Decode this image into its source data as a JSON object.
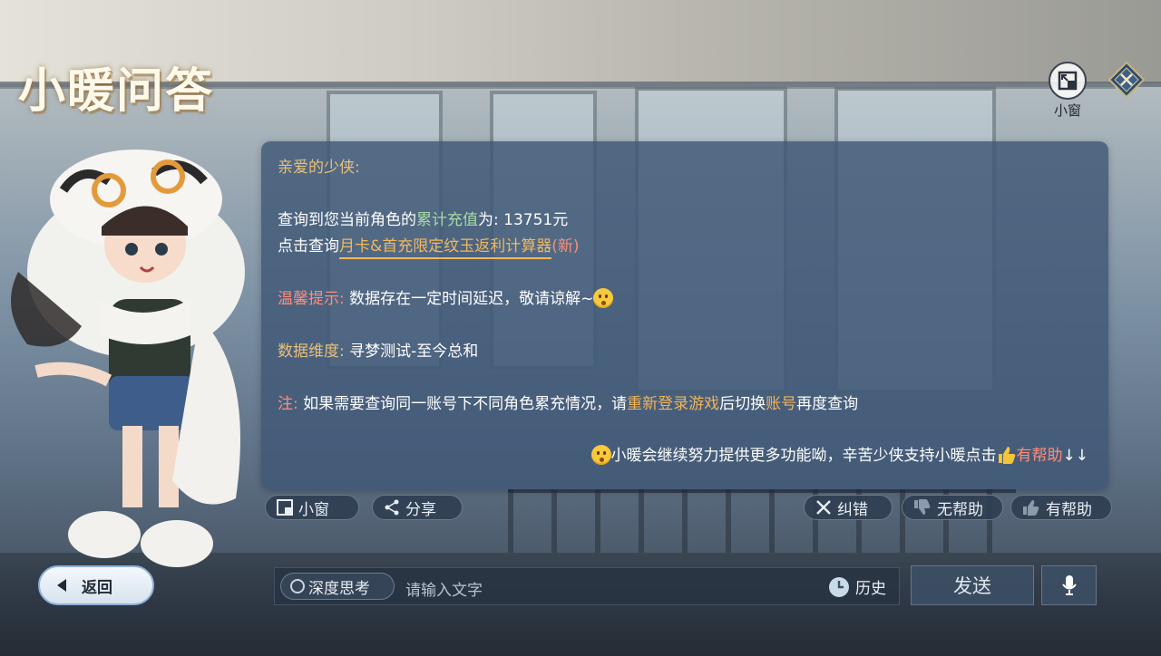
{
  "header": {
    "title": "小暖问答",
    "mini_window_label": "小窗"
  },
  "dialog": {
    "greeting": "亲爱的少侠:",
    "query_prefix": "查询到您当前角色的",
    "query_highlight": "累计充值",
    "query_suffix": "为: 13751元",
    "click_prefix": "点击查询",
    "calculator_link": "月卡&首充限定纹玉返利计算器",
    "calculator_new": "(新)",
    "tip_label": "温馨提示:",
    "tip_text": "数据存在一定时间延迟，敬请谅解~",
    "dimension_label": "数据维度:",
    "dimension_value": "寻梦测试-至今总和",
    "note_label": "注:",
    "note_prefix": "如果需要查询同一账号下不同角色累充情况，请",
    "note_relogin": "重新登录游戏",
    "note_middle": "后切换",
    "note_account": "账号",
    "note_suffix": "再度查询",
    "closing_text": "小暖会继续努力提供更多功能呦，辛苦少侠支持小暖点击",
    "closing_helpful": "有帮助",
    "closing_arrows": "↓↓"
  },
  "actions": {
    "mini_window": "小窗",
    "share": "分享",
    "correct": "纠错",
    "not_helpful": "无帮助",
    "helpful": "有帮助"
  },
  "bottom": {
    "back": "返回",
    "deep_think": "深度思考",
    "input_placeholder": "请输入文字",
    "history": "历史",
    "send": "发送"
  },
  "colors": {
    "dialog_bg": "#40587699",
    "gold": "#e8c07a",
    "green": "#a9d9a5",
    "orange": "#f1b45a",
    "red": "#ff8d78"
  }
}
